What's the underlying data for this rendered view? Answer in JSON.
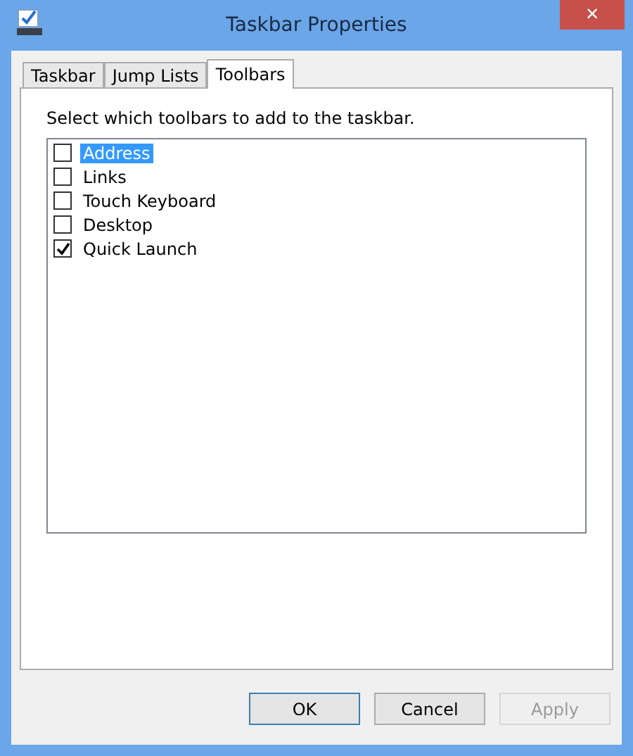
{
  "window": {
    "title": "Taskbar Properties",
    "close": "×"
  },
  "tabs": [
    {
      "label": "Taskbar",
      "selected": false
    },
    {
      "label": "Jump Lists",
      "selected": false
    },
    {
      "label": "Toolbars",
      "selected": true
    }
  ],
  "instruction": "Select which toolbars to add to the taskbar.",
  "toolbars": [
    {
      "label": "Address",
      "checked": false,
      "selected": true
    },
    {
      "label": "Links",
      "checked": false,
      "selected": false
    },
    {
      "label": "Touch Keyboard",
      "checked": false,
      "selected": false
    },
    {
      "label": "Desktop",
      "checked": false,
      "selected": false
    },
    {
      "label": "Quick Launch",
      "checked": true,
      "selected": false
    }
  ],
  "buttons": [
    {
      "label": "OK",
      "default": true,
      "disabled": false
    },
    {
      "label": "Cancel",
      "default": false,
      "disabled": false
    },
    {
      "label": "Apply",
      "default": false,
      "disabled": true
    }
  ]
}
